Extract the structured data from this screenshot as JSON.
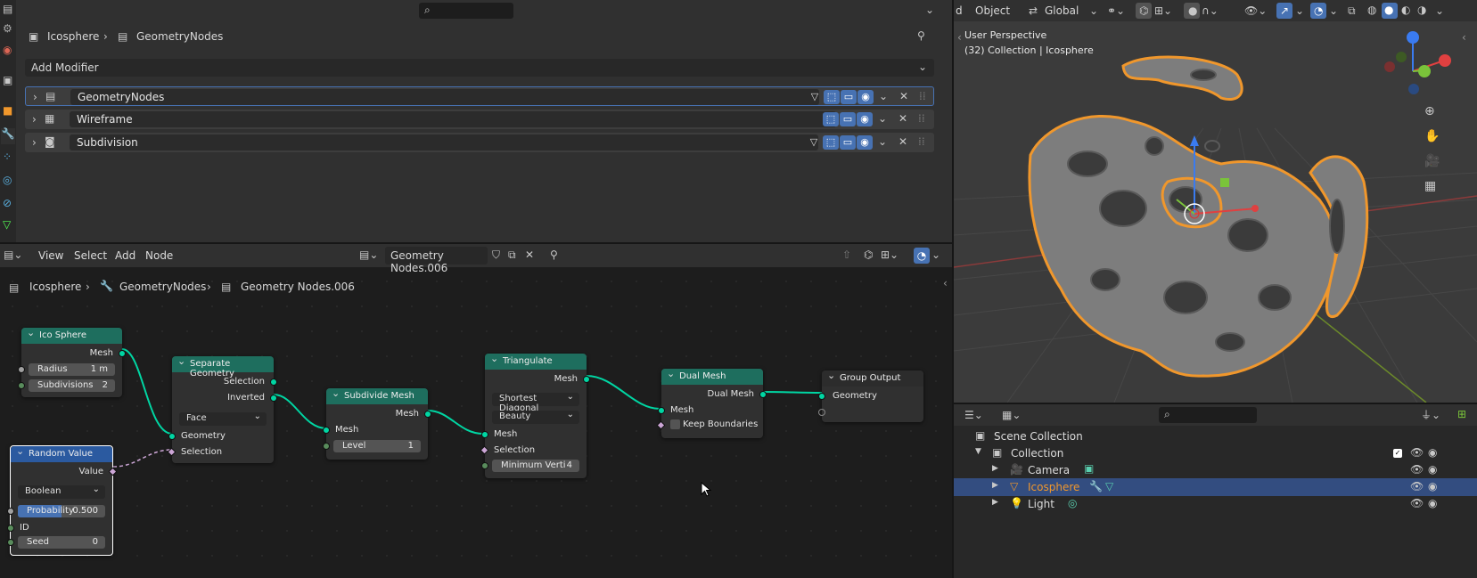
{
  "properties": {
    "search_placeholder": "",
    "breadcrumb_object": "Icosphere",
    "breadcrumb_modifier": "GeometryNodes",
    "add_modifier_label": "Add Modifier",
    "modifiers": [
      {
        "name": "GeometryNodes",
        "icon": "geometry-nodes-icon"
      },
      {
        "name": "Wireframe",
        "icon": "wireframe-icon"
      },
      {
        "name": "Subdivision",
        "icon": "subdivision-icon"
      }
    ]
  },
  "viewport_header": {
    "mode_tail": "d",
    "object_menu": "Object",
    "orientation": "Global"
  },
  "viewport": {
    "perspective_label": "User Perspective",
    "collection_label": "(32) Collection | Icosphere"
  },
  "node_editor": {
    "menus": [
      "View",
      "Select",
      "Add",
      "Node"
    ],
    "tree_name": "Geometry Nodes.006",
    "breadcrumb": [
      "Icosphere",
      "GeometryNodes",
      "Geometry Nodes.006"
    ],
    "nodes": {
      "ico_sphere": {
        "title": "Ico Sphere",
        "out_mesh": "Mesh",
        "radius_label": "Radius",
        "radius_value": "1 m",
        "subdiv_label": "Subdivisions",
        "subdiv_value": "2"
      },
      "random_value": {
        "title": "Random Value",
        "out_value": "Value",
        "type": "Boolean",
        "prob_label": "Probability",
        "prob_value": "0.500",
        "id_label": "ID",
        "seed_label": "Seed",
        "seed_value": "0"
      },
      "separate_geometry": {
        "title": "Separate Geometry",
        "out_selection": "Selection",
        "out_inverted": "Inverted",
        "domain": "Face",
        "in_geometry": "Geometry",
        "in_selection": "Selection"
      },
      "subdivide_mesh": {
        "title": "Subdivide Mesh",
        "out_mesh": "Mesh",
        "in_mesh": "Mesh",
        "level_label": "Level",
        "level_value": "1"
      },
      "triangulate": {
        "title": "Triangulate",
        "out_mesh": "Mesh",
        "quad_method": "Shortest Diagonal",
        "ngon_method": "Beauty",
        "in_mesh": "Mesh",
        "in_selection": "Selection",
        "min_label": "Minimum Verti",
        "min_value": "4"
      },
      "dual_mesh": {
        "title": "Dual Mesh",
        "out_dual": "Dual Mesh",
        "in_mesh": "Mesh",
        "keep_label": "Keep Boundaries"
      },
      "group_output": {
        "title": "Group Output",
        "in_geometry": "Geometry"
      }
    }
  },
  "outliner": {
    "search_placeholder": "",
    "rows": [
      {
        "label": "Scene Collection"
      },
      {
        "label": "Collection"
      },
      {
        "label": "Camera"
      },
      {
        "label": "Icosphere"
      },
      {
        "label": "Light"
      }
    ]
  },
  "colors": {
    "accent_blue": "#4772b3",
    "node_teal": "#1e6e5e",
    "selection_orange": "#f0972c",
    "outliner_selected": "#334d80"
  }
}
